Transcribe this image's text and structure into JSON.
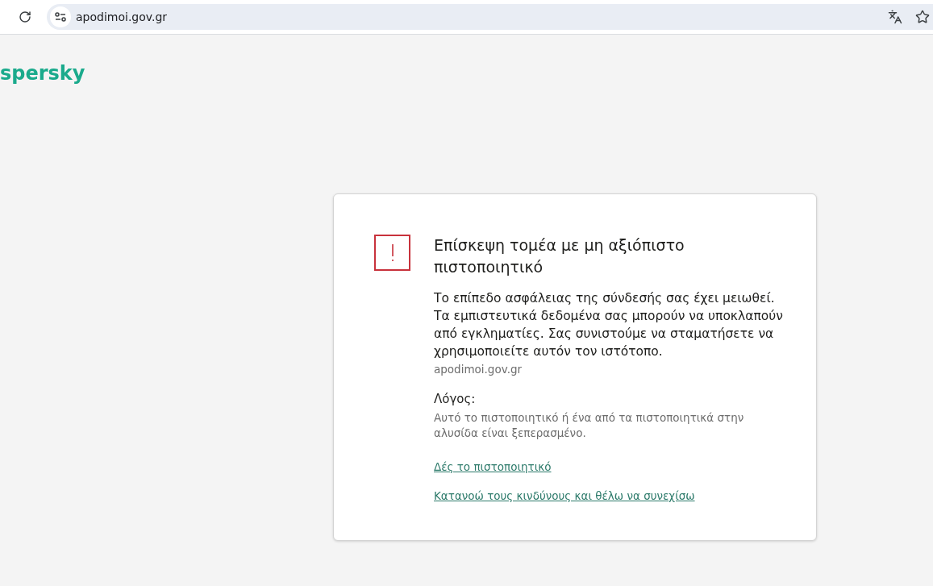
{
  "browser": {
    "url": "apodimoi.gov.gr"
  },
  "logo": "spersky",
  "warning": {
    "title": "Επίσκεψη τομέα με μη αξιόπιστο πιστοποιητικό",
    "message": "Το επίπεδο ασφάλειας της σύνδεσής σας έχει μειωθεί. Τα εμπιστευτικά δεδομένα σας μπορούν να υποκλαπούν από εγκληματίες. Σας συνιστούμε να σταματήσετε να χρησιμοποιείτε αυτόν τον ιστότοπο.",
    "domain": "apodimoi.gov.gr",
    "reason_label": "Λόγος:",
    "reason": "Αυτό το πιστοποιητικό ή ένα από τα πιστοποιητικά στην αλυσίδα είναι ξεπερασμένο.",
    "links": [
      "Δές το πιστοποιητικό",
      "Κατανοώ τους κινδύνους και θέλω να συνεχίσω"
    ]
  }
}
